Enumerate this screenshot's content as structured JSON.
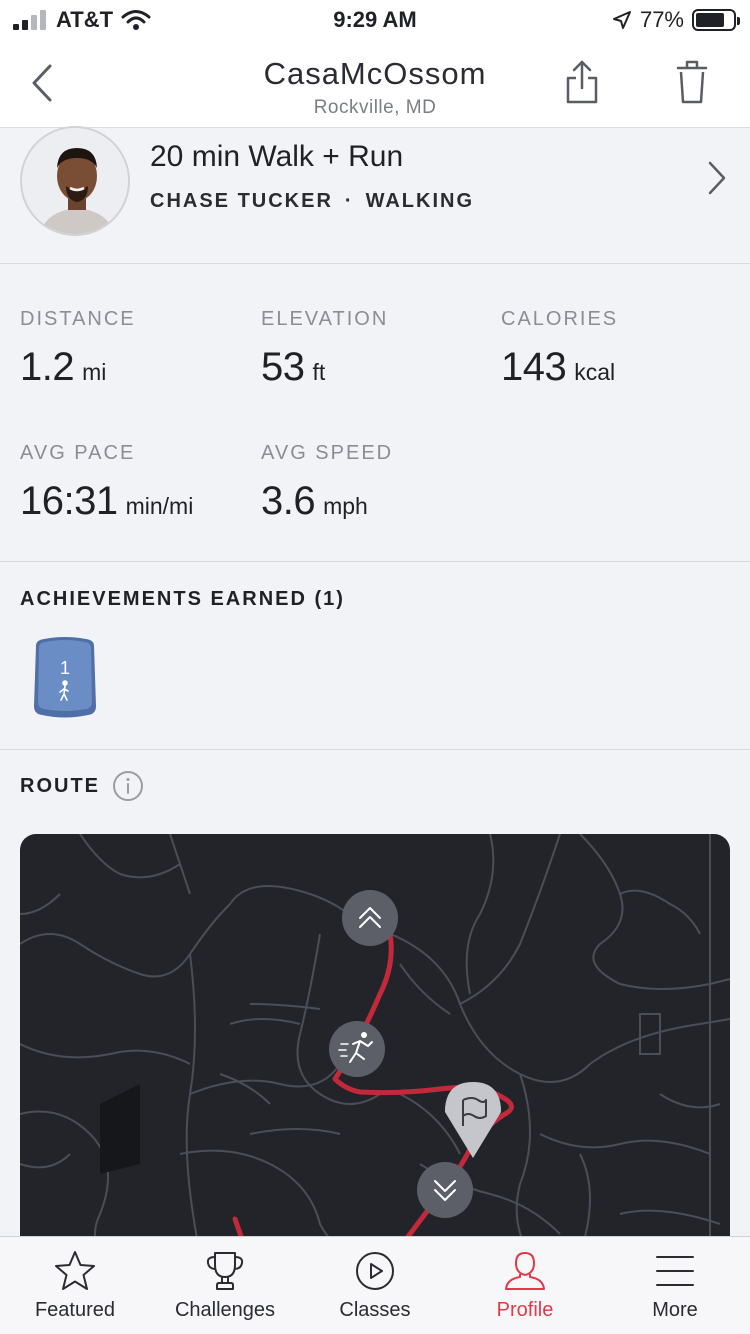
{
  "status_bar": {
    "carrier": "AT&T",
    "time": "9:29 AM",
    "battery": "77%",
    "battery_level": 0.77
  },
  "header": {
    "title": "CasaMcOssom",
    "subtitle": "Rockville, MD",
    "icons": [
      "back-chevron-icon",
      "share-icon",
      "trash-icon"
    ]
  },
  "class": {
    "title": "20 min Walk + Run",
    "instructor": "CHASE TUCKER",
    "separator": "·",
    "type": "WALKING"
  },
  "stats": [
    {
      "label": "DISTANCE",
      "value": "1.2",
      "unit": "mi"
    },
    {
      "label": "ELEVATION",
      "value": "53",
      "unit": "ft"
    },
    {
      "label": "CALORIES",
      "value": "143",
      "unit": "kcal"
    },
    {
      "label": "AVG PACE",
      "value": "16:31",
      "unit": "min/mi"
    },
    {
      "label": "AVG SPEED",
      "value": "3.6",
      "unit": "mph"
    }
  ],
  "achievements": {
    "title": "ACHIEVEMENTS EARNED (1)",
    "badges": [
      {
        "number": "1",
        "icon": "walker-icon"
      }
    ]
  },
  "route": {
    "title": "ROUTE"
  },
  "tabs": [
    {
      "label": "Featured",
      "icon": "star-icon",
      "active": false
    },
    {
      "label": "Challenges",
      "icon": "trophy-icon",
      "active": false
    },
    {
      "label": "Classes",
      "icon": "play-circle-icon",
      "active": false
    },
    {
      "label": "Profile",
      "icon": "person-icon",
      "active": true
    },
    {
      "label": "More",
      "icon": "menu-icon",
      "active": false
    }
  ],
  "colors": {
    "accent": "#e03a4a",
    "route": "#c22a3c",
    "map_bg": "#22242a",
    "badge_blue": "#5c7fb8"
  }
}
